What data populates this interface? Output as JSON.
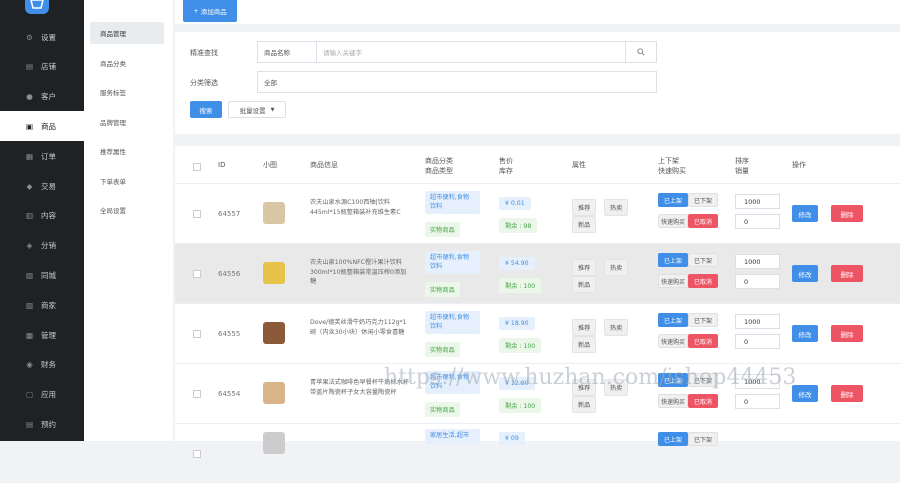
{
  "sidebar": {
    "items": [
      {
        "label": "设置",
        "icon": "gear-icon"
      },
      {
        "label": "店铺",
        "icon": "store-icon"
      },
      {
        "label": "客户",
        "icon": "user-icon"
      },
      {
        "label": "商品",
        "icon": "bag-icon"
      },
      {
        "label": "订单",
        "icon": "order-icon"
      },
      {
        "label": "交易",
        "icon": "trade-icon"
      },
      {
        "label": "内容",
        "icon": "content-icon"
      },
      {
        "label": "分销",
        "icon": "share-icon"
      },
      {
        "label": "同城",
        "icon": "city-icon"
      },
      {
        "label": "商家",
        "icon": "merchant-icon"
      },
      {
        "label": "管理",
        "icon": "manage-icon"
      },
      {
        "label": "财务",
        "icon": "finance-icon"
      },
      {
        "label": "应用",
        "icon": "app-icon"
      },
      {
        "label": "预约",
        "icon": "calendar-icon"
      }
    ]
  },
  "subnav": {
    "items": [
      "商品管理",
      "商品分类",
      "服务标签",
      "品牌管理",
      "推荐属性",
      "下单表单",
      "全局设置"
    ]
  },
  "toolbar": {
    "add_label": "添加商品"
  },
  "filter": {
    "search_label": "精准查找",
    "field_select": "商品名称",
    "search_placeholder": "请输入关键字",
    "category_label": "分类筛选",
    "category_value": "全部",
    "search_button": "搜索",
    "batch_button": "批量设置"
  },
  "table": {
    "headers": {
      "id": "ID",
      "thumb": "小图",
      "info": "商品信息",
      "cat1": "商品分类",
      "cat2": "商品类型",
      "price1": "售价",
      "price2": "库存",
      "attr": "属性",
      "shelf1": "上下架",
      "shelf2": "快速购买",
      "sort1": "排序",
      "sort2": "销量",
      "ops": "操作"
    },
    "labels": {
      "recommend": "推荐",
      "hot": "热卖",
      "new": "新品",
      "on_shelf": "已上架",
      "off_shelf": "已下架",
      "quick_buy": "快速购买",
      "canceled": "已取消",
      "edit": "修改",
      "delete": "删除"
    },
    "rows": [
      {
        "id": "64557",
        "name": "农夫山泉水源C100西柚|饮料445ml*15瓶整箱装补充维生素C",
        "category": "超市便利,食物饮料",
        "type": "实物商品",
        "price": "¥ 0.01",
        "stock": "剩余 : 98",
        "sort": "1000",
        "sales": "0",
        "thumb_color": "#d8c6a4"
      },
      {
        "id": "64556",
        "name": "农夫山泉100%NFC橙汁果汁饮料300ml*10瓶整箱装常温压榨0添加糖",
        "category": "超市便利,食物饮料",
        "type": "实物商品",
        "price": "¥ 54.90",
        "stock": "剩余 : 100",
        "sort": "1000",
        "sales": "0",
        "thumb_color": "#e6c44a"
      },
      {
        "id": "64555",
        "name": "Dove/德芙丝滑牛奶巧克力112g*1碗（内含30小块）休闲小零食喜糖",
        "category": "超市便利,食物饮料",
        "type": "实物商品",
        "price": "¥ 18.90",
        "stock": "剩余 : 100",
        "sort": "1000",
        "sales": "0",
        "thumb_color": "#8a5a3a"
      },
      {
        "id": "64554",
        "name": "青苹果法式咖啡色早餐杯牛奶杯水杯带盖片陶瓷杯子女大容量陶瓷杯",
        "category": "超市便利,食物饮料",
        "type": "实物商品",
        "price": "¥ 12.90",
        "stock": "剩余 : 100",
        "sort": "1000",
        "sales": "0",
        "thumb_color": "#d9b48a"
      },
      {
        "id": "",
        "name": "",
        "category": "家居生活,超市",
        "type": "",
        "price": "¥ 09",
        "stock": "",
        "sort": "",
        "sales": "",
        "thumb_color": "#cccccc"
      }
    ]
  },
  "watermark": "https://www.huzhan.com/ishop44453",
  "colors": {
    "sidebar": "#1f2225",
    "primary": "#3f8ee8",
    "danger": "#ed5565",
    "success": "#48a54a"
  }
}
